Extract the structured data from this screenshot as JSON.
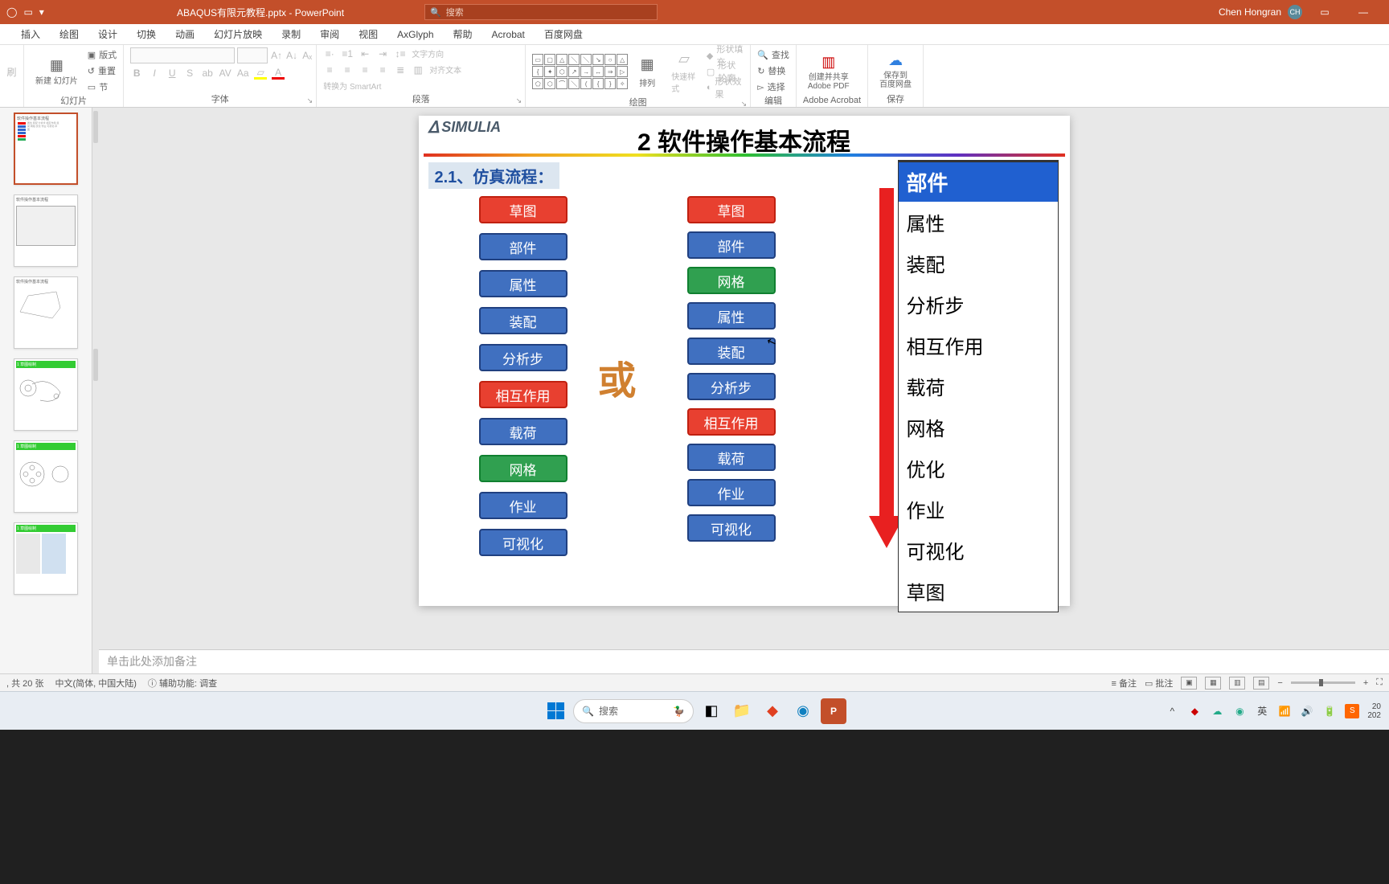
{
  "titlebar": {
    "filename": "ABAQUS有限元教程.pptx - PowerPoint",
    "search_placeholder": "搜索",
    "username": "Chen Hongran",
    "avatar": "CH"
  },
  "tabs": [
    "插入",
    "绘图",
    "设计",
    "切换",
    "动画",
    "幻灯片放映",
    "录制",
    "审阅",
    "视图",
    "AxGlyph",
    "帮助",
    "Acrobat",
    "百度网盘"
  ],
  "ribbon": {
    "slides": {
      "new_slide": "新建\n幻灯片",
      "layout": "版式",
      "reset": "重置",
      "section": "节",
      "group": "幻灯片"
    },
    "font_group": "字体",
    "para_group": "段落",
    "text_dir": "文字方向",
    "align_text": "对齐文本",
    "smartart": "转换为 SmartArt",
    "draw_group": "绘图",
    "arrange": "排列",
    "quick_style": "快速样式",
    "shape_fill": "形状填充",
    "shape_outline": "形状轮廓",
    "shape_effects": "形状效果",
    "find": "查找",
    "replace": "替换",
    "select": "选择",
    "edit_group": "编辑",
    "create_share": "创建并共享",
    "adobe_pdf": "Adobe PDF",
    "acrobat_group": "Adobe Acrobat",
    "save_to": "保存到",
    "baidu": "百度网盘",
    "save_group": "保存"
  },
  "slide": {
    "logo": "SIMULIA",
    "title": "2 软件操作基本流程",
    "section": "2.1、仿真流程：",
    "or": "或",
    "col1": [
      {
        "t": "草图",
        "c": "fb-red"
      },
      {
        "t": "部件",
        "c": "fb-blue"
      },
      {
        "t": "属性",
        "c": "fb-blue"
      },
      {
        "t": "装配",
        "c": "fb-blue"
      },
      {
        "t": "分析步",
        "c": "fb-blue"
      },
      {
        "t": "相互作用",
        "c": "fb-red"
      },
      {
        "t": "载荷",
        "c": "fb-blue"
      },
      {
        "t": "网格",
        "c": "fb-green"
      },
      {
        "t": "作业",
        "c": "fb-blue"
      },
      {
        "t": "可视化",
        "c": "fb-blue"
      }
    ],
    "col2": [
      {
        "t": "草图",
        "c": "fb-red"
      },
      {
        "t": "部件",
        "c": "fb-blue"
      },
      {
        "t": "网格",
        "c": "fb-green"
      },
      {
        "t": "属性",
        "c": "fb-blue"
      },
      {
        "t": "装配",
        "c": "fb-blue"
      },
      {
        "t": "分析步",
        "c": "fb-blue"
      },
      {
        "t": "相互作用",
        "c": "fb-red"
      },
      {
        "t": "载荷",
        "c": "fb-blue"
      },
      {
        "t": "作业",
        "c": "fb-blue"
      },
      {
        "t": "可视化",
        "c": "fb-blue"
      }
    ],
    "sidebar_header": "部件",
    "sidebar_items": [
      "属性",
      "装配",
      "分析步",
      "相互作用",
      "载荷",
      "网格",
      "优化",
      "作业",
      "可视化",
      "草图"
    ]
  },
  "thumbs_labels": [
    "软件操作基本流程",
    "软件操作基本流程",
    "软件操作基本流程",
    "1 草图绘制",
    "1 草图绘制",
    "1 草图绘制",
    ""
  ],
  "notes_placeholder": "单击此处添加备注",
  "status": {
    "slide_count": ", 共 20 张",
    "lang": "中文(简体, 中国大陆)",
    "access": "辅助功能: 调查",
    "notes_btn": "备注",
    "comments_btn": "批注"
  },
  "taskbar": {
    "search": "搜索",
    "time": "20",
    "date": "202"
  }
}
